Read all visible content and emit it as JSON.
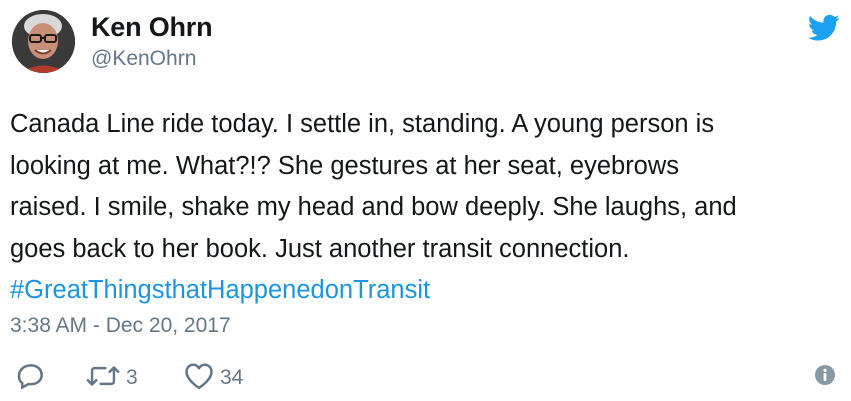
{
  "user": {
    "name": "Ken Ohrn",
    "handle": "@KenOhrn"
  },
  "tweet": {
    "lines": [
      "Canada Line ride today. I settle in, standing. A young person is",
      "looking at me. What?!? She gestures at her seat, eyebrows",
      "raised. I smile, shake my head and bow deeply. She laughs, and",
      "goes back to her book. Just another transit connection."
    ],
    "hashtag": "#GreatThingsthatHappenedonTransit",
    "timestamp": "3:38 AM - Dec 20, 2017"
  },
  "actions": {
    "retweet_count": "3",
    "like_count": "34"
  },
  "icons": {
    "brand": "twitter-bird-icon",
    "reply": "reply-icon",
    "retweet": "retweet-icon",
    "like": "heart-icon",
    "info": "info-icon"
  },
  "colors": {
    "brand": "#1da1f2",
    "hashtag": "#1b95e0",
    "secondary_text": "#657786",
    "primary_text": "#14171a"
  }
}
